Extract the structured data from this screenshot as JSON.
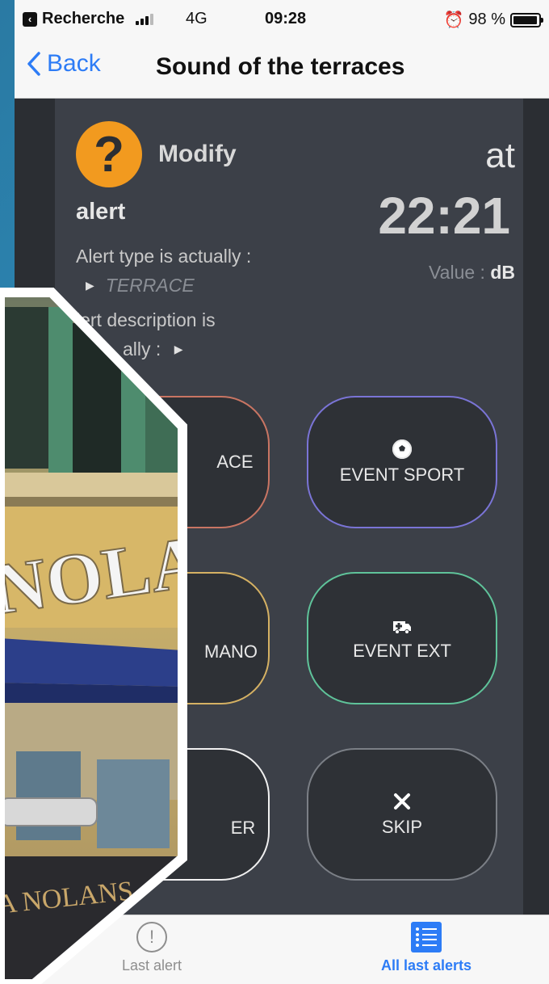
{
  "status": {
    "back_app": "Recherche",
    "network": "4G",
    "time": "09:28",
    "battery": "98 %",
    "battery_level": 0.98
  },
  "nav": {
    "back_label": "Back",
    "title": "Sound of the terraces"
  },
  "header": {
    "modify": "Modify",
    "alert": "alert",
    "at": "at",
    "time": "22:21",
    "type_label": "Alert type is actually :",
    "type_value": "TERRACE",
    "value_label": "Value :",
    "value_unit": "dB",
    "desc_label_start": "lert description is",
    "desc_label_end": "ally :"
  },
  "buttons": {
    "terrace": "ACE",
    "sport": "EVENT SPORT",
    "mano": "MANO",
    "ext": "EVENT EXT",
    "other": "ER",
    "skip": "SKIP"
  },
  "tabs": {
    "last_alert": "Last alert",
    "all_last_alerts": "All last alerts"
  },
  "photo": {
    "sign_text": "NOLANS",
    "lower_sign_text": "A NOLANS"
  },
  "colors": {
    "accent_blue": "#2d7cf6",
    "question_orange": "#f29a1f",
    "terrace_border": "#c97563",
    "sport_border": "#7a74d6",
    "mano_border": "#d5b163",
    "ext_border": "#5fc39a"
  }
}
